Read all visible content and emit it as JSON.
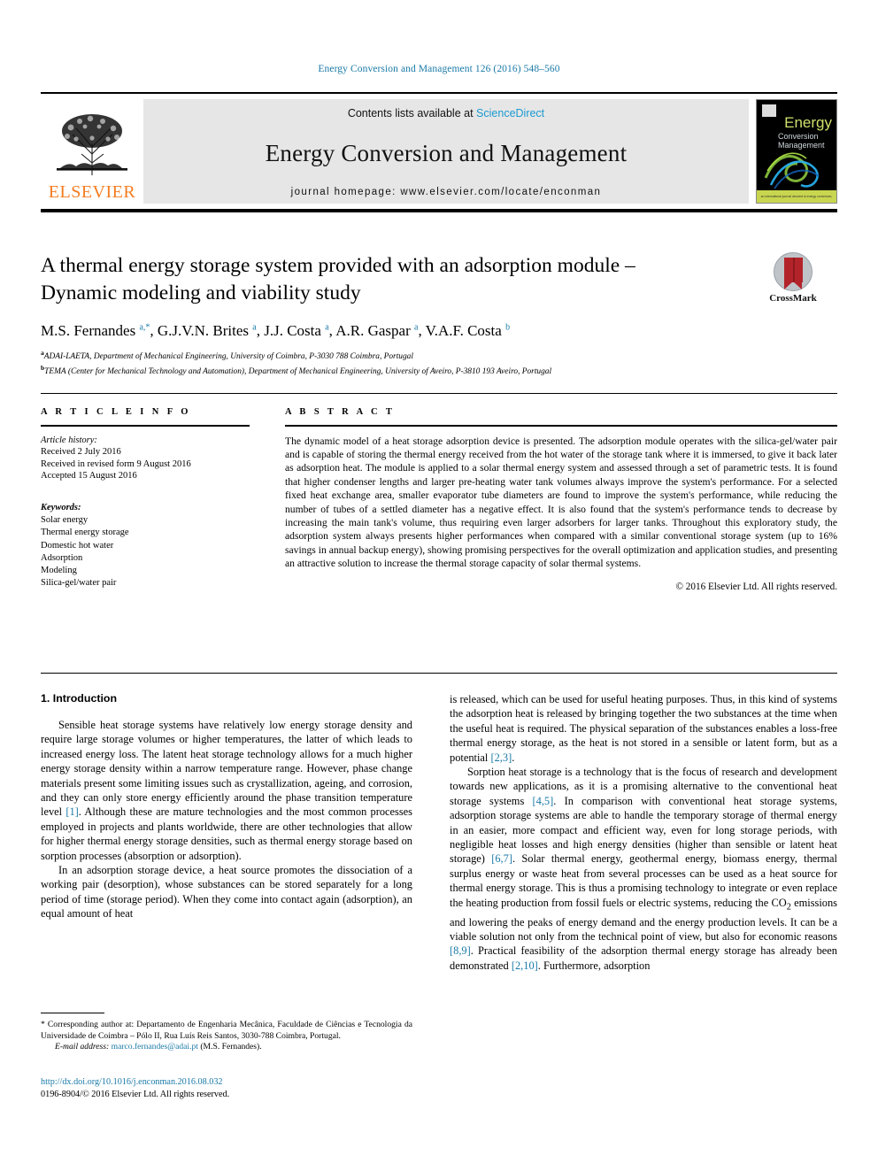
{
  "running_head": "Energy Conversion and Management 126 (2016) 548–560",
  "masthead": {
    "publisher_name": "ELSEVIER",
    "contents_prefix": "Contents lists available at",
    "contents_link": "ScienceDirect",
    "journal_title": "Energy Conversion and Management",
    "homepage": "journal homepage: www.elsevier.com/locate/enconman",
    "cover": {
      "line1": "Energy",
      "line2": "Conversion",
      "line3": "Management",
      "footer_text": "an international journal devoted to energy conversion, conservation and management"
    }
  },
  "crossmark": {
    "label": "CrossMark"
  },
  "article": {
    "title": "A thermal energy storage system provided with an adsorption module – Dynamic modeling and viability study",
    "authors_html": "M.S. Fernandes <sup>a,*</sup>, G.J.V.N. Brites <sup>a</sup>, J.J. Costa <sup>a</sup>, A.R. Gaspar <sup>a</sup>, V.A.F. Costa <sup>b</sup>",
    "affiliations": [
      "ADAI-LAETA, Department of Mechanical Engineering, University of Coimbra, P-3030 788 Coimbra, Portugal",
      "TEMA (Center for Mechanical Technology and Automation), Department of Mechanical Engineering, University of Aveiro, P-3810 193 Aveiro, Portugal"
    ],
    "affiliation_marks": [
      "a",
      "b"
    ]
  },
  "article_info": {
    "heading": "A R T I C L E   I N F O",
    "history_label": "Article history:",
    "history": [
      "Received 2 July 2016",
      "Received in revised form 9 August 2016",
      "Accepted 15 August 2016"
    ],
    "keywords_label": "Keywords:",
    "keywords": [
      "Solar energy",
      "Thermal energy storage",
      "Domestic hot water",
      "Adsorption",
      "Modeling",
      "Silica-gel/water pair"
    ]
  },
  "abstract": {
    "heading": "A B S T R A C T",
    "text": "The dynamic model of a heat storage adsorption device is presented. The adsorption module operates with the silica-gel/water pair and is capable of storing the thermal energy received from the hot water of the storage tank where it is immersed, to give it back later as adsorption heat. The module is applied to a solar thermal energy system and assessed through a set of parametric tests. It is found that higher condenser lengths and larger pre-heating water tank volumes always improve the system's performance. For a selected fixed heat exchange area, smaller evaporator tube diameters are found to improve the system's performance, while reducing the number of tubes of a settled diameter has a negative effect. It is also found that the system's performance tends to decrease by increasing the main tank's volume, thus requiring even larger adsorbers for larger tanks. Throughout this exploratory study, the adsorption system always presents higher performances when compared with a similar conventional storage system (up to 16% savings in annual backup energy), showing promising perspectives for the overall optimization and application studies, and presenting an attractive solution to increase the thermal storage capacity of solar thermal systems.",
    "copyright": "© 2016 Elsevier Ltd. All rights reserved."
  },
  "introduction": {
    "heading": "1. Introduction",
    "left_paragraphs": [
      "Sensible heat storage systems have relatively low energy storage density and require large storage volumes or higher temperatures, the latter of which leads to increased energy loss. The latent heat storage technology allows for a much higher energy storage density within a narrow temperature range. However, phase change materials present some limiting issues such as crystallization, ageing, and corrosion, and they can only store energy efficiently around the phase transition temperature level [1]. Although these are mature technologies and the most common processes employed in projects and plants worldwide, there are other technologies that allow for higher thermal energy storage densities, such as thermal energy storage based on sorption processes (absorption or adsorption).",
      "In an adsorption storage device, a heat source promotes the dissociation of a working pair (desorption), whose substances can be stored separately for a long period of time (storage period). When they come into contact again (adsorption), an equal amount of heat"
    ],
    "right_paragraphs": [
      "is released, which can be used for useful heating purposes. Thus, in this kind of systems the adsorption heat is released by bringing together the two substances at the time when the useful heat is required. The physical separation of the substances enables a loss-free thermal energy storage, as the heat is not stored in a sensible or latent form, but as a potential [2,3].",
      "Sorption heat storage is a technology that is the focus of research and development towards new applications, as it is a promising alternative to the conventional heat storage systems [4,5]. In comparison with conventional heat storage systems, adsorption storage systems are able to handle the temporary storage of thermal energy in an easier, more compact and efficient way, even for long storage periods, with negligible heat losses and high energy densities (higher than sensible or latent heat storage) [6,7]. Solar thermal energy, geothermal energy, biomass energy, thermal surplus energy or waste heat from several processes can be used as a heat source for thermal energy storage. This is thus a promising technology to integrate or even replace the heating production from fossil fuels or electric systems, reducing the CO2 emissions and lowering the peaks of energy demand and the energy production levels. It can be a viable solution not only from the technical point of view, but also for economic reasons [8,9]. Practical feasibility of the adsorption thermal energy storage has already been demonstrated [2,10]. Furthermore, adsorption"
    ]
  },
  "footnote": {
    "corresponding": "* Corresponding author at: Departamento de Engenharia Mecânica, Faculdade de Ciências e Tecnologia da Universidade de Coimbra – Pólo II, Rua Luís Reis Santos, 3030-788 Coimbra, Portugal.",
    "email_label": "E-mail address:",
    "email": "marco.fernandes@adai.pt",
    "email_suffix": "(M.S. Fernandes)."
  },
  "footer": {
    "doi": "http://dx.doi.org/10.1016/j.enconman.2016.08.032",
    "issn_line": "0196-8904/© 2016 Elsevier Ltd. All rights reserved."
  },
  "colors": {
    "link_blue": "#1a7aa8",
    "sciencedirect_blue": "#1a9ad0",
    "elsevier_orange": "#F47C20",
    "masthead_gray": "#e6e6e6",
    "crossmark_red": "#b3242a"
  }
}
